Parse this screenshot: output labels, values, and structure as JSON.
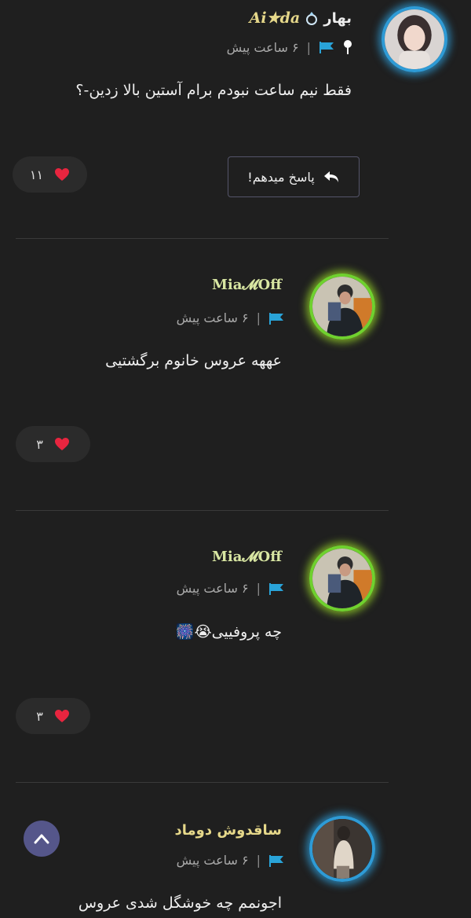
{
  "comments": [
    {
      "author_fa": "بهار",
      "author_en": "Ai★da",
      "time": "۶ ساعت پیش",
      "body": "فقط نیم ساعت نبودم برام آستین بالا زدین-؟",
      "likes": "۱۱",
      "reply_label": "پاسخ میدهم!",
      "pinned": true
    },
    {
      "author": "Mia𝓜Off",
      "time": "۶ ساعت پیش",
      "body": "عههه عروس خانوم برگشتیی",
      "likes": "۳"
    },
    {
      "author": "Mia𝓜Off",
      "time": "۶ ساعت پیش",
      "body": "چه پروفییی😭🎆",
      "likes": "۳"
    },
    {
      "author": "ساقدوش دوماد",
      "time": "۶ ساعت پیش",
      "body": "اجونمم چه خوشگل شدی عروس"
    }
  ],
  "colors": {
    "background": "#1f1f1f",
    "flag": "#29a3d8",
    "heart": "#e8253f",
    "glow_blue": "#2e9bd6",
    "glow_green": "#6fd12e",
    "scroll_button": "#55568a"
  },
  "icons": {
    "pin": "pin-icon",
    "flag": "flag-icon",
    "heart": "heart-icon",
    "reply": "reply-arrow-icon",
    "scroll_top": "chevron-up-icon"
  }
}
